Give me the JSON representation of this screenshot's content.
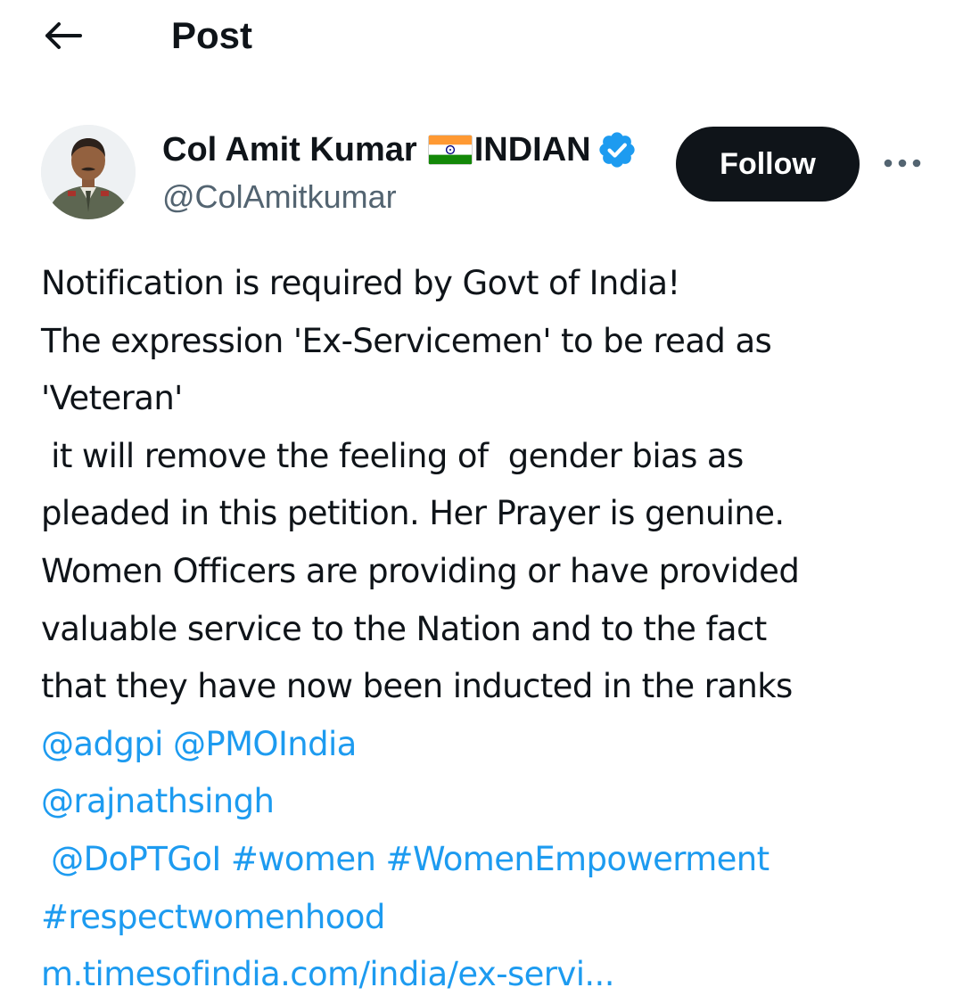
{
  "header": {
    "title": "Post",
    "back_icon": "arrow-left-icon"
  },
  "author": {
    "display_name": "Col Amit Kumar",
    "flag_icon": "india-flag-icon",
    "name_suffix": "INDIAN",
    "verified_icon": "verified-badge-icon",
    "handle": "@ColAmitkumar"
  },
  "actions": {
    "follow_label": "Follow",
    "more_icon": "more-options-icon"
  },
  "post": {
    "text_lines": [
      "Notification is required by Govt of India!",
      "The expression 'Ex-Servicemen' to be read as",
      "'Veteran'",
      " it will remove the feeling of  gender bias as",
      "pleaded in this petition. Her Prayer is genuine.",
      "Women Officers are providing or have provided",
      "valuable service to the Nation and to the fact",
      "that they have now been inducted in the ranks"
    ],
    "mention_adgpi": "@adgpi",
    "mention_pmo": "@PMOIndia",
    "mention_rajnath": "@rajnathsingh",
    "mention_dopt": "@DoPTGoI",
    "hashtag_women": "#women",
    "hashtag_empowerment": "#WomenEmpowerment",
    "hashtag_respect": "#respectwomenhood",
    "link_text": "m.timesofindia.com/india/ex-servi..."
  },
  "colors": {
    "text": "#0f1419",
    "secondary": "#536471",
    "link": "#1d9bf0",
    "follow_bg": "#0f1419",
    "verified": "#1d9bf0"
  }
}
